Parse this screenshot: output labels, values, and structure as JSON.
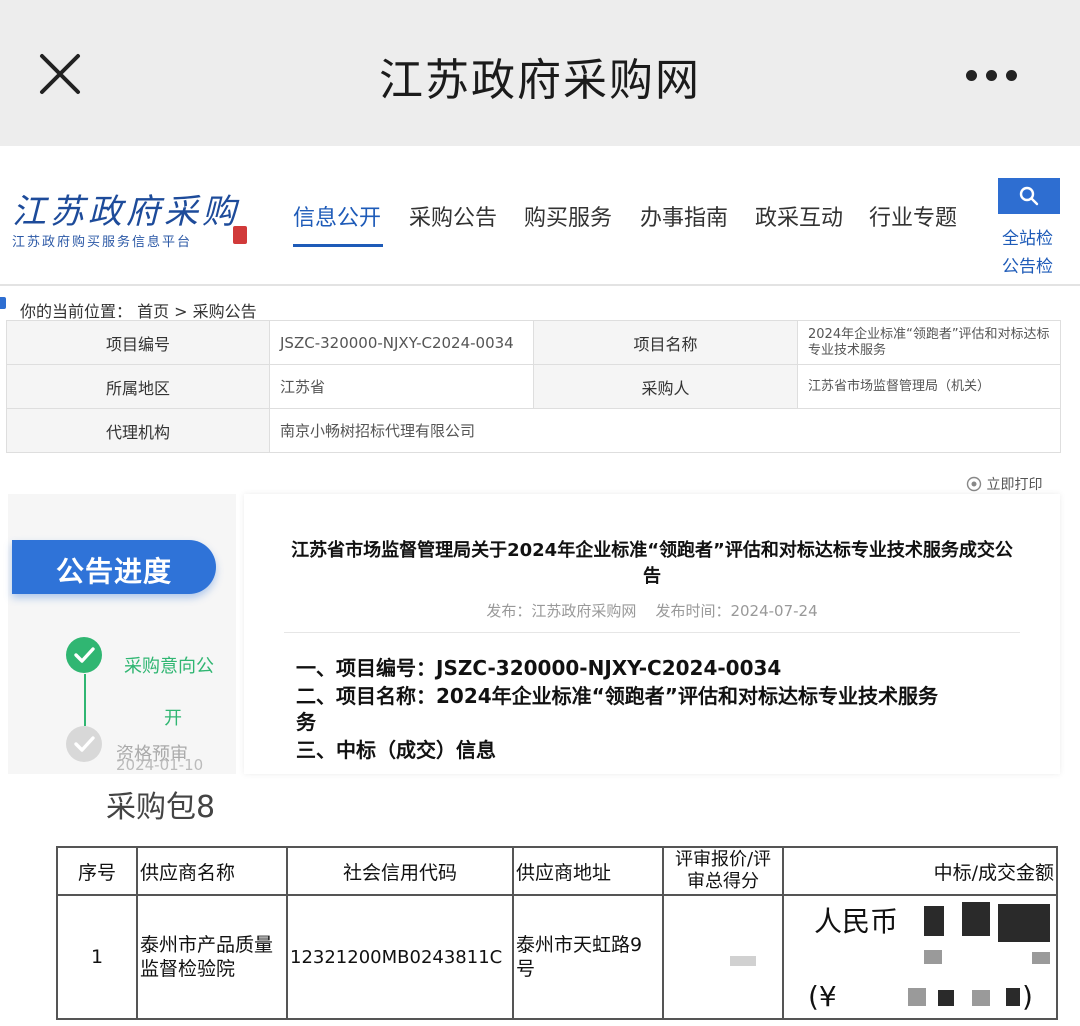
{
  "appbar": {
    "title": "江苏政府采购网"
  },
  "site": {
    "logo_text": "江苏政府采购",
    "logo_subtitle": "江苏政府购买服务信息平台",
    "nav": [
      "信息公开",
      "采购公告",
      "购买服务",
      "办事指南",
      "政采互动",
      "行业专题"
    ],
    "active_nav": "信息公开",
    "side_links": [
      "全站检",
      "公告检"
    ]
  },
  "breadcrumb": "你的当前位置： 首页 > 采购公告",
  "info": {
    "project_no_label": "项目编号",
    "project_no": "JSZC-320000-NJXY-C2024-0034",
    "project_name_label": "项目名称",
    "project_name": "2024年企业标准“领跑者”评估和对标达标专业技术服务",
    "region_label": "所属地区",
    "region": "江苏省",
    "buyer_label": "采购人",
    "buyer": "江苏省市场监督管理局（机关）",
    "agency_label": "代理机构",
    "agency": "南京小畅树招标代理有限公司"
  },
  "print_label": "立即打印",
  "progress": {
    "tab_label": "公告进度",
    "step1_line1": "采购意向公",
    "step1_line2": "开",
    "step2_label": "资格预审",
    "step2_date": "2024-01-10"
  },
  "article": {
    "title": "江苏省市场监督管理局关于2024年企业标准“领跑者”评估和对标达标专业技术服务成交公告",
    "meta": "发布：江苏政府采购网    发布时间：2024-07-24",
    "line1": "一、项目编号：JSZC-320000-NJXY-C2024-0034",
    "line2a": "二、项目名称：2024年企业标准“领跑者”评估和对标达标专业技术服务",
    "line2b": "务",
    "line3": "三、中标（成交）信息"
  },
  "package": {
    "title": "采购包8",
    "headers": {
      "seq": "序号",
      "supplier": "供应商名称",
      "credit_code": "社会信用代码",
      "address": "供应商地址",
      "score": "评审报价/评审总得分",
      "amount": "中标/成交金额"
    },
    "row": {
      "seq": "1",
      "supplier": "泰州市产品质量监督检验院",
      "credit_code": "12321200MB0243811C",
      "address": "泰州市天虹路9号",
      "amount_prefix": "人民币",
      "amount_paren_open": "(¥",
      "amount_paren_close": ")"
    }
  }
}
